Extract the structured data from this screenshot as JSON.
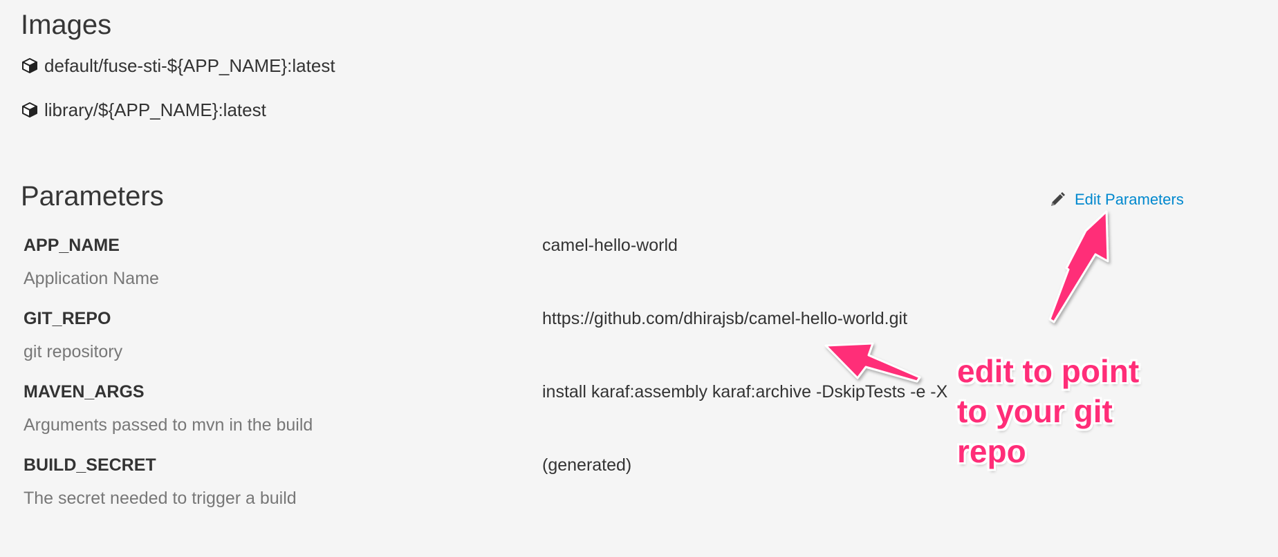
{
  "images_section": {
    "title": "Images",
    "items": [
      {
        "label": "default/fuse-sti-${APP_NAME}:latest",
        "icon": "cube-icon"
      },
      {
        "label": "library/${APP_NAME}:latest",
        "icon": "cube-icon"
      }
    ]
  },
  "parameters_section": {
    "title": "Parameters",
    "edit_link": {
      "label": "Edit Parameters",
      "icon": "pencil-icon",
      "color": "#0088ce"
    },
    "rows": [
      {
        "name": "APP_NAME",
        "description": "Application Name",
        "value": "camel-hello-world"
      },
      {
        "name": "GIT_REPO",
        "description": "git repository",
        "value": "https://github.com/dhirajsb/camel-hello-world.git"
      },
      {
        "name": "MAVEN_ARGS",
        "description": "Arguments passed to mvn in the build",
        "value": "install karaf:assembly karaf:archive -DskipTests -e -X"
      },
      {
        "name": "BUILD_SECRET",
        "description": "The secret needed to trigger a build",
        "value": "(generated)"
      }
    ]
  },
  "annotation": {
    "line1": "edit to point",
    "line2": "to your git",
    "line3": "repo",
    "color": "#ff2d78"
  }
}
